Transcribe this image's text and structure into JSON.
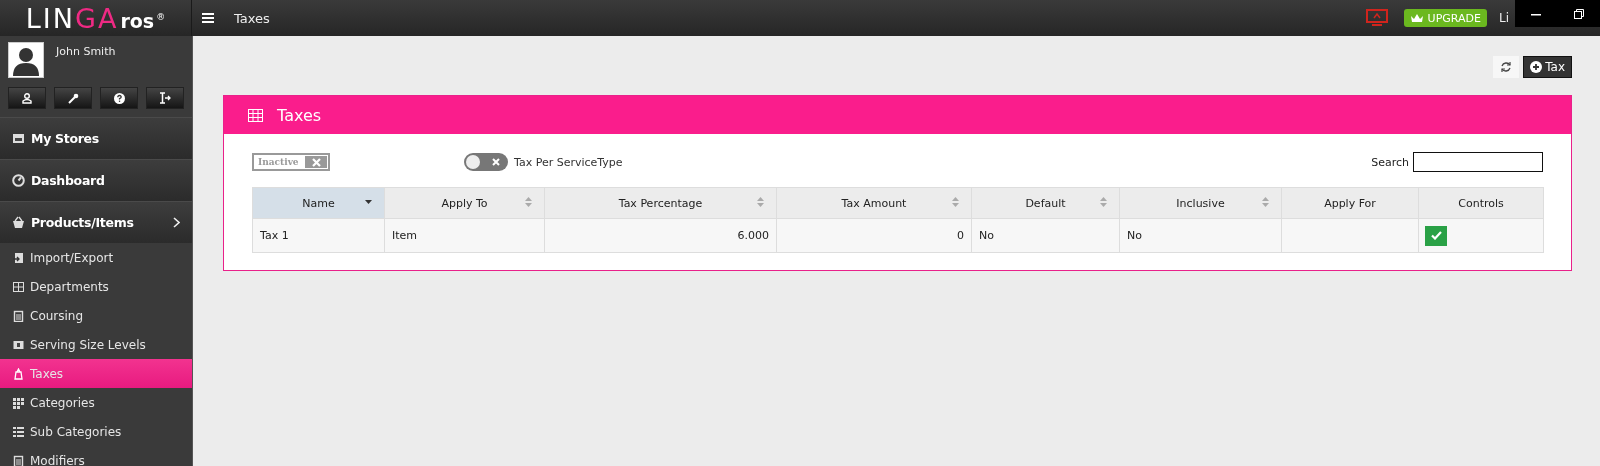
{
  "logo": {
    "parts": [
      {
        "text": "LIN",
        "kind": "plain"
      },
      {
        "text": "GA",
        "kind": "accent"
      },
      {
        "text": "ros",
        "kind": "suffix"
      }
    ],
    "mark": "®"
  },
  "topbar": {
    "title": "Taxes",
    "upgrade": "UPGRADE",
    "user": "Li"
  },
  "profile": {
    "name": "John Smith"
  },
  "sidebar": {
    "sections": [
      {
        "label": "My Stores",
        "expandable": false
      },
      {
        "label": "Dashboard",
        "expandable": false
      },
      {
        "label": "Products/Items",
        "expandable": true
      }
    ],
    "items": [
      {
        "label": "Import/Export",
        "selected": false
      },
      {
        "label": "Departments",
        "selected": false
      },
      {
        "label": "Coursing",
        "selected": false
      },
      {
        "label": "Serving Size Levels",
        "selected": false
      },
      {
        "label": "Taxes",
        "selected": true
      },
      {
        "label": "Categories",
        "selected": false
      },
      {
        "label": "Sub Categories",
        "selected": false
      },
      {
        "label": "Modifiers",
        "selected": false
      }
    ]
  },
  "actions": {
    "add": "Tax"
  },
  "panel": {
    "title": "Taxes",
    "inactive": {
      "label": "Inactive",
      "on": false
    },
    "service_type": {
      "label": "Tax Per ServiceType",
      "on": false
    },
    "search": {
      "label": "Search"
    },
    "table": {
      "columns": [
        "Name",
        "Apply To",
        "Tax Percentage",
        "Tax Amount",
        "Default",
        "Inclusive",
        "Apply For",
        "Controls"
      ],
      "rows": [
        {
          "cells": [
            "Tax 1",
            "Item",
            "6.000",
            "0",
            "No",
            "No"
          ],
          "active": true
        }
      ]
    }
  }
}
